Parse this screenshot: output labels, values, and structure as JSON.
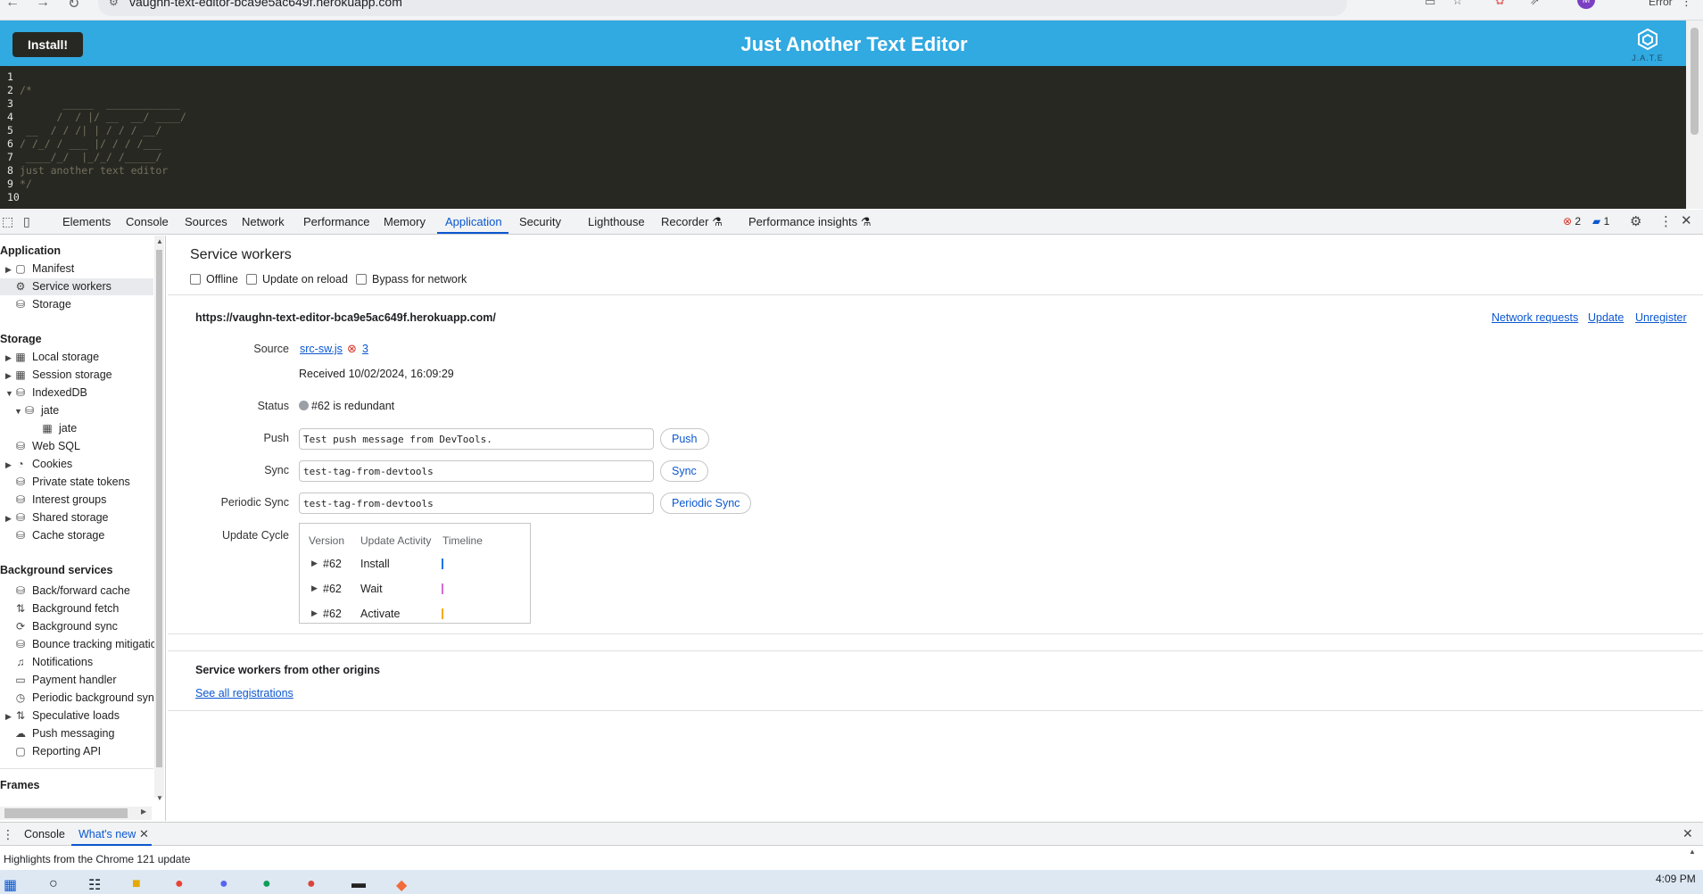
{
  "browser": {
    "url": "vaughn-text-editor-bca9e5ac649f.herokuapp.com",
    "profile_initial": "M",
    "error_label": "Error"
  },
  "app": {
    "install_label": "Install!",
    "title": "Just Another Text Editor",
    "logo_text": "J.A.T.E"
  },
  "editor": {
    "lines": [
      {
        "n": "1",
        "t": ""
      },
      {
        "n": "2",
        "t": "/*"
      },
      {
        "n": "3",
        "t": "       _____  ____________"
      },
      {
        "n": "4",
        "t": "      /  / |/ __  __/ ____/"
      },
      {
        "n": "5",
        "t": " __  / / /| | / / / __/"
      },
      {
        "n": "6",
        "t": "/ /_/ / ___ |/ / / /___"
      },
      {
        "n": "7",
        "t": " ____/_/  |_/_/ /_____/"
      },
      {
        "n": "8",
        "t": "just another text editor"
      },
      {
        "n": "9",
        "t": "*/"
      },
      {
        "n": "10",
        "t": ""
      }
    ]
  },
  "devtools": {
    "tabs": [
      "Elements",
      "Console",
      "Sources",
      "Network",
      "Performance",
      "Memory",
      "Application",
      "Security",
      "Lighthouse",
      "Recorder",
      "Performance insights"
    ],
    "active_tab": "Application",
    "error_count": "2",
    "message_count": "1"
  },
  "sidebar": {
    "application_head": "Application",
    "application_items": [
      "Manifest",
      "Service workers",
      "Storage"
    ],
    "storage_head": "Storage",
    "storage_items": [
      "Local storage",
      "Session storage",
      "IndexedDB",
      "jate",
      "jate",
      "Web SQL",
      "Cookies",
      "Private state tokens",
      "Interest groups",
      "Shared storage",
      "Cache storage"
    ],
    "background_head": "Background services",
    "background_items": [
      "Back/forward cache",
      "Background fetch",
      "Background sync",
      "Bounce tracking mitigatic",
      "Notifications",
      "Payment handler",
      "Periodic background sync",
      "Speculative loads",
      "Push messaging",
      "Reporting API"
    ],
    "frames_head": "Frames"
  },
  "main": {
    "title": "Service workers",
    "offline_label": "Offline",
    "update_on_reload_label": "Update on reload",
    "bypass_label": "Bypass for network",
    "origin": "https://vaughn-text-editor-bca9e5ac649f.herokuapp.com/",
    "network_requests_link": "Network requests",
    "update_link": "Update",
    "unregister_link": "Unregister",
    "source_label": "Source",
    "source_file": "src-sw.js",
    "source_error_count": "3",
    "received": "Received 10/02/2024, 16:09:29",
    "status_label": "Status",
    "status_value": "#62 is redundant",
    "push_label": "Push",
    "push_value": "Test push message from DevTools.",
    "push_button": "Push",
    "sync_label": "Sync",
    "sync_value": "test-tag-from-devtools",
    "sync_button": "Sync",
    "periodic_label": "Periodic Sync",
    "periodic_value": "test-tag-from-devtools",
    "periodic_button": "Periodic Sync",
    "cycle_label": "Update Cycle",
    "cycle_headers": [
      "Version",
      "Update Activity",
      "Timeline"
    ],
    "cycle_rows": [
      {
        "version": "#62",
        "activity": "Install",
        "color": "#1a73e8"
      },
      {
        "version": "#62",
        "activity": "Wait",
        "color": "#d56bd1"
      },
      {
        "version": "#62",
        "activity": "Activate",
        "color": "#f9ab00"
      }
    ],
    "other_origins_title": "Service workers from other origins",
    "see_all_link": "See all registrations"
  },
  "drawer": {
    "tabs": [
      "Console",
      "What's new"
    ],
    "active_tab": "What's new",
    "content": "Highlights from the Chrome 121 update"
  },
  "taskbar": {
    "time": "4:09 PM"
  }
}
